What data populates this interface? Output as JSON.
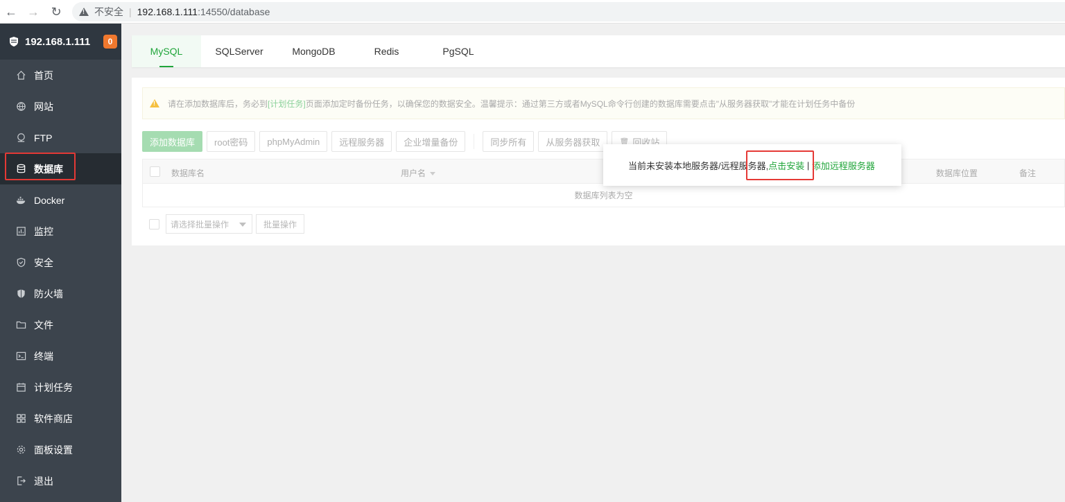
{
  "browser": {
    "insecure_label": "不安全",
    "url_host": "192.168.1.111",
    "url_path": ":14550/database"
  },
  "sidebar": {
    "host": "192.168.1.111",
    "badge": "0",
    "items": [
      {
        "label": "首页",
        "icon": "home-icon"
      },
      {
        "label": "网站",
        "icon": "globe-icon"
      },
      {
        "label": "FTP",
        "icon": "ftp-icon"
      },
      {
        "label": "数据库",
        "icon": "database-icon"
      },
      {
        "label": "Docker",
        "icon": "docker-icon"
      },
      {
        "label": "监控",
        "icon": "monitor-icon"
      },
      {
        "label": "安全",
        "icon": "shield-check-icon"
      },
      {
        "label": "防火墙",
        "icon": "firewall-icon"
      },
      {
        "label": "文件",
        "icon": "folder-icon"
      },
      {
        "label": "终端",
        "icon": "terminal-icon"
      },
      {
        "label": "计划任务",
        "icon": "calendar-icon"
      },
      {
        "label": "软件商店",
        "icon": "grid-icon"
      },
      {
        "label": "面板设置",
        "icon": "gear-icon"
      },
      {
        "label": "退出",
        "icon": "logout-icon"
      }
    ],
    "active_index": 3
  },
  "tabs": [
    "MySQL",
    "SQLServer",
    "MongoDB",
    "Redis",
    "PgSQL"
  ],
  "notice": {
    "text_before": "请在添加数据库后，务必到",
    "link": "[计划任务]",
    "text_after": "页面添加定时备份任务，以确保您的数据安全。温馨提示：通过第三方或者MySQL命令行创建的数据库需要点击\"从服务器获取\"才能在计划任务中备份"
  },
  "toolbar": {
    "add_db": "添加数据库",
    "root_pwd": "root密码",
    "phpmyadmin": "phpMyAdmin",
    "remote_server": "远程服务器",
    "enterprise_backup": "企业增量备份",
    "sync_all": "同步所有",
    "fetch_from_server": "从服务器获取",
    "recycle_bin": "回收站"
  },
  "table": {
    "columns": {
      "name": "数据库名",
      "user": "用户名",
      "location": "数据库位置",
      "remark": "备注"
    },
    "empty_text": "数据库列表为空"
  },
  "batch": {
    "select_placeholder": "请选择批量操作",
    "button": "批量操作"
  },
  "popup": {
    "message": "当前未安装本地服务器/远程服务器,",
    "install_link": "点击安装",
    "separator": " | ",
    "add_remote_link": "添加远程服务器"
  },
  "colors": {
    "accent": "#20a53a",
    "sidebar_bg": "#3c444d",
    "badge": "#f0782e",
    "highlight_box": "#e53935"
  }
}
